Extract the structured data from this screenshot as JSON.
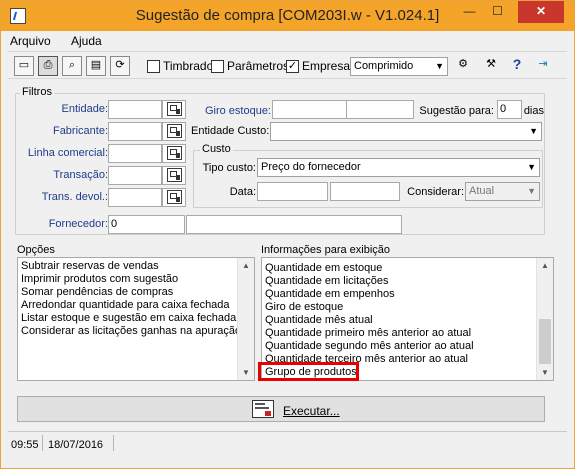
{
  "window": {
    "title": "Sugestão de compra [COM203I.w - V1.024.1]",
    "minimize": "—",
    "maximize": "☐",
    "close": "✕"
  },
  "menu": {
    "items": [
      "Arquivo",
      "Ajuda"
    ]
  },
  "toolbar": {
    "checkboxes": [
      {
        "label": "Timbrado",
        "checked": false
      },
      {
        "label": "Parâmetros",
        "checked": false
      },
      {
        "label": "Empresa",
        "checked": true
      }
    ],
    "format_select": "Comprimido",
    "icons": [
      "printer-icon",
      "print-preview-icon",
      "export-icon",
      "folder-icon",
      "refresh-icon",
      "filter-icon",
      "tools-icon",
      "help-icon",
      "exit-icon"
    ]
  },
  "filtros": {
    "title": "Filtros",
    "labels": {
      "entidade": "Entidade:",
      "fabricante": "Fabricante:",
      "linha": "Linha comercial:",
      "transacao": "Transação:",
      "trans_devol": "Trans. devol.:",
      "fornecedor": "Fornecedor:",
      "giro": "Giro estoque:",
      "sugestao": "Sugestão para:",
      "dias": "dias",
      "entidade_custo": "Entidade Custo:"
    },
    "values": {
      "fornecedor": "0",
      "sugestao": "0",
      "entidade": "",
      "fabricante": "",
      "linha": "",
      "transacao": "",
      "trans_devol": "",
      "giro_from": "",
      "giro_to": "",
      "entidade_custo": ""
    }
  },
  "custo": {
    "title": "Custo",
    "tipo_label": "Tipo custo:",
    "tipo_value": "Preço do fornecedor",
    "data_label": "Data:",
    "considerar_label": "Considerar:",
    "considerar_value": "Atual"
  },
  "opcoes": {
    "title": "Opções",
    "items": [
      "Subtrair reservas de vendas",
      "Imprimir produtos com sugestão",
      "Somar pendências de compras",
      "Arredondar quantidade para caixa fechada",
      "Listar estoque e sugestão em caixa fechada",
      "Considerar as licitações ganhas na apuração"
    ]
  },
  "informacoes": {
    "title": "Informações para exibição",
    "items": [
      "Quantidade em estoque",
      "Quantidade em licitações",
      "Quantidade em empenhos",
      "Giro de estoque",
      "Quantidade mês atual",
      "Quantidade primeiro mês anterior ao atual",
      "Quantidade segundo mês anterior ao atual",
      "Quantidade terceiro mês anterior ao atual",
      "Grupo de produtos"
    ],
    "highlighted_item": "Grupo de produtos"
  },
  "executar": {
    "label": "Executar..."
  },
  "status": {
    "time": "09:55",
    "date": "18/07/2016"
  },
  "colors": {
    "titlebar": "#f5a42a",
    "highlight": "#e60000",
    "label_blue": "#1f3c8a"
  }
}
